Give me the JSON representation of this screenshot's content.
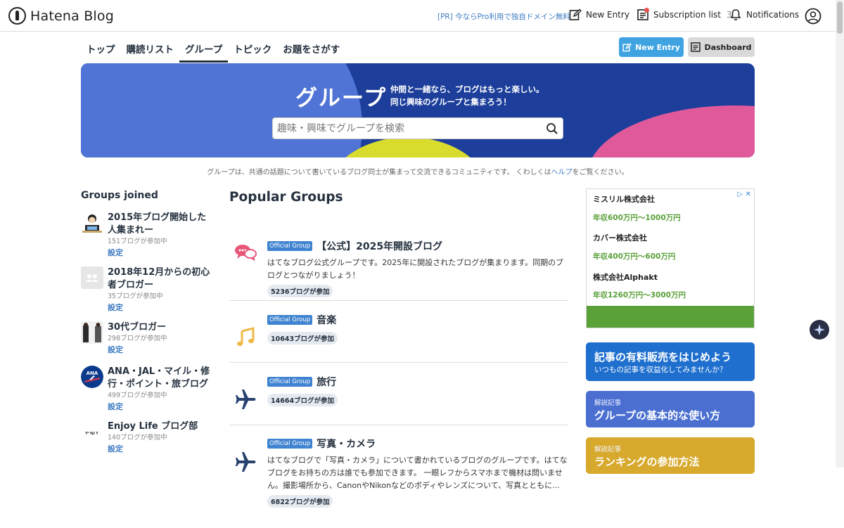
{
  "header": {
    "logo_text": "Hatena Blog",
    "pr_link": "[PR] 今ならPro利用で独自ドメイン無料",
    "new_entry": "New Entry",
    "subscription_label": "Subscription list",
    "subscription_count": "3",
    "notifications": "Notifications"
  },
  "nav": {
    "items": [
      "トップ",
      "購読リスト",
      "グループ",
      "トピック",
      "お題をさがす"
    ],
    "active": "グループ",
    "new_entry_button": "New Entry",
    "dashboard_button": "Dashboard"
  },
  "hero": {
    "title": "グループ",
    "tagline_1": "仲間と一緒なら、ブログはもっと楽しい。",
    "tagline_2": "同じ興味のグループと集まろう！",
    "search_placeholder": "趣味・興味でグループを検索"
  },
  "description": {
    "text_before": "グループは、共通の話題について書いているブログ同士が集まって交流できるコミュニティです。 くわしくは",
    "link": "ヘルプ",
    "text_after": "をご覧ください。"
  },
  "groups_joined": {
    "title": "Groups joined",
    "items": [
      {
        "name": "2015年ブログ開始した人集まれー",
        "count": "151ブログが参加中",
        "settings": "設定"
      },
      {
        "name": "2018年12月からの初心者ブロガー",
        "count": "35ブログが参加中",
        "settings": "設定"
      },
      {
        "name": "30代ブロガー",
        "count": "298ブログが参加中",
        "settings": "設定"
      },
      {
        "name": "ANA・JAL・マイル・修行・ポイント・旅ブログ",
        "count": "499ブログが参加中",
        "settings": "設定"
      },
      {
        "name": "Enjoy Life ブログ部",
        "count": "140ブログが参加中",
        "settings": "設定"
      }
    ]
  },
  "popular_groups": {
    "title": "Popular Groups",
    "official_label": "Official Group",
    "items": [
      {
        "name": "【公式】2025年開設ブログ",
        "desc": "はてなブログ公式グループです。2025年に開設されたブログが集まります。同期のブログとつながりましょう！",
        "count": "5236ブログが参加",
        "icon": "speech-bubbles-icon"
      },
      {
        "name": "音楽",
        "desc": "",
        "count": "10643ブログが参加",
        "icon": "music-note-icon"
      },
      {
        "name": "旅行",
        "desc": "",
        "count": "14664ブログが参加",
        "icon": "airplane-icon"
      },
      {
        "name": "写真・カメラ",
        "desc": "はてなブログで「写真・カメラ」について書かれているブログのグループです。はてなブログをお持ちの方は誰でも参加できます。 一眼レフからスマホまで機材は問いません。撮影場所から、CanonやNikonなどのボディやレンズについて、写真とともに...",
        "count": "6822ブログが参加",
        "icon": "airplane-icon"
      }
    ]
  },
  "ad": {
    "rows": [
      {
        "company": "ミスリル株式会社",
        "salary": "年収600万円〜1000万円"
      },
      {
        "company": "カバー株式会社",
        "salary": "年収400万円〜600万円"
      },
      {
        "company": "株式会社Alphakt",
        "salary": "年収1260万円〜3000万円"
      }
    ]
  },
  "banners": [
    {
      "title": "記事の有料販売をはじめよう",
      "subtitle": "いつもの記事を収益化してみませんか？"
    },
    {
      "tag": "解説記事",
      "title": "グループの基本的な使い方"
    },
    {
      "tag": "解説記事",
      "title": "ランキングの参加方法"
    }
  ],
  "colors": {
    "accent": "#3fa3e2",
    "hero_bg": "#1d3f9b",
    "official_badge": "#3f83d1",
    "salary_green": "#5aa13a"
  }
}
